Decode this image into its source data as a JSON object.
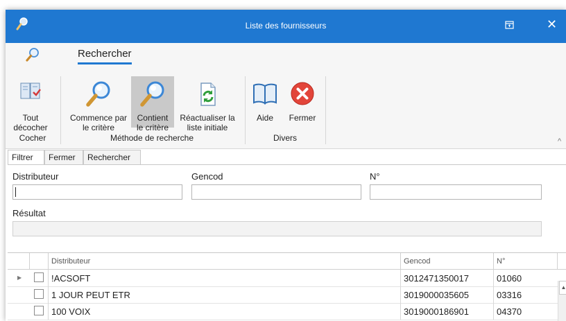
{
  "window": {
    "title": "Liste des fournisseurs",
    "title_bar_color": "#1f78d1"
  },
  "ribbon": {
    "tab_label": "Rechercher",
    "buttons": {
      "uncheck_all": {
        "line1": "Tout",
        "line2": "décocher",
        "icon": "uncheck-list-icon"
      },
      "starts_with": {
        "line1": "Commence par",
        "line2": "le critère",
        "icon": "magnifier-icon"
      },
      "contains": {
        "line1": "Contient",
        "line2": "le critère",
        "icon": "magnifier-icon"
      },
      "refresh": {
        "line1": "Réactualiser la",
        "line2": "liste initiale",
        "icon": "refresh-document-icon"
      },
      "help": {
        "line1": "Aide",
        "icon": "book-icon"
      },
      "close": {
        "line1": "Fermer",
        "icon": "red-x-icon"
      }
    },
    "groups": {
      "check": "Cocher",
      "search_method": "Méthode de recherche",
      "misc": "Divers"
    }
  },
  "tabs": [
    "Filtrer",
    "Fermer",
    "Rechercher"
  ],
  "filter": {
    "distributor_label": "Distributeur",
    "gencod_label": "Gencod",
    "number_label": "N°",
    "result_label": "Résultat",
    "distributor_value": "",
    "gencod_value": "",
    "number_value": "",
    "result_value": ""
  },
  "grid": {
    "columns": [
      "Distributeur",
      "Gencod",
      "N°"
    ],
    "rows": [
      {
        "distributor": "!ACSOFT",
        "gencod": "3012471350017",
        "number": "01060"
      },
      {
        "distributor": "1 JOUR PEUT ETR",
        "gencod": "3019000035605",
        "number": "03316"
      },
      {
        "distributor": "100 VOIX",
        "gencod": "3019000186901",
        "number": "04370"
      }
    ]
  }
}
